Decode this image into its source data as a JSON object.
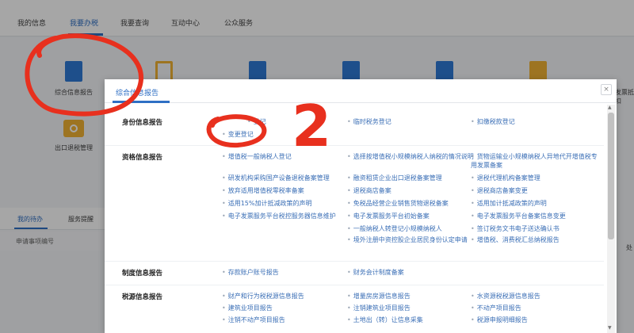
{
  "topnav": {
    "tabs": [
      "我的信息",
      "我要办税",
      "我要查询",
      "互动中心",
      "公众服务"
    ],
    "active": "我要办税"
  },
  "background": {
    "tiles": [
      {
        "label": "综合信息报告",
        "color": "#2f7ad6"
      },
      {
        "label": "出口退税管理",
        "color": "#f2b233"
      }
    ],
    "bottom_tabs": [
      "我的待办",
      "服务提醒"
    ],
    "table_header": "申请事项编号",
    "right_cut_text": "发票抵扣",
    "right_cut_text2": "处"
  },
  "modal": {
    "title": "综合信息报告",
    "close_label": "×",
    "sections": [
      {
        "title": "身份信息报告",
        "links": [
          "登记",
          "临时税务登记",
          "扣缴税款登记",
          "变更登记"
        ]
      },
      {
        "title": "资格信息报告",
        "links": [
          "增值税一般纳税人登记",
          "选择按增值税小规模纳税人纳税的情况说明",
          "货物运输业小规模纳税人异地代开增值税专用发票备案",
          "研发机构采购国产设备退税备案管理",
          "融资租赁企业出口退税备案管理",
          "退税代理机构备案管理",
          "放弃适用增值税零税率备案",
          "退税商店备案",
          "退税商店备案变更",
          "适用15%加计抵减政策的声明",
          "免税品经营企业销售货物退税备案",
          "适用加计抵减政策的声明",
          "电子发票服务平台税控服务器信息维护",
          "电子发票服务平台初始备案",
          "电子发票服务平台备案信息变更",
          "一般纳税人转登记小规模纳税人",
          "签订税务文书电子送达确认书",
          "境外注册中资控股企业居民身份认定申请",
          "增值税、消费税汇总纳税报告"
        ]
      },
      {
        "title": "制度信息报告",
        "links": [
          "存款账户账号报告",
          "财务会计制度备案"
        ]
      },
      {
        "title": "税源信息报告",
        "links": [
          "财产和行为税税源信息报告",
          "增量房房源信息报告",
          "水资源税税源信息报告",
          "建筑业项目报告",
          "注销建筑业项目报告",
          "不动产项目报告",
          "注销不动产项目报告",
          "土地出（转）让信息采集",
          "税源申报明细报告"
        ]
      }
    ]
  },
  "annotations": {
    "number": "2",
    "color": "#e8301e"
  }
}
